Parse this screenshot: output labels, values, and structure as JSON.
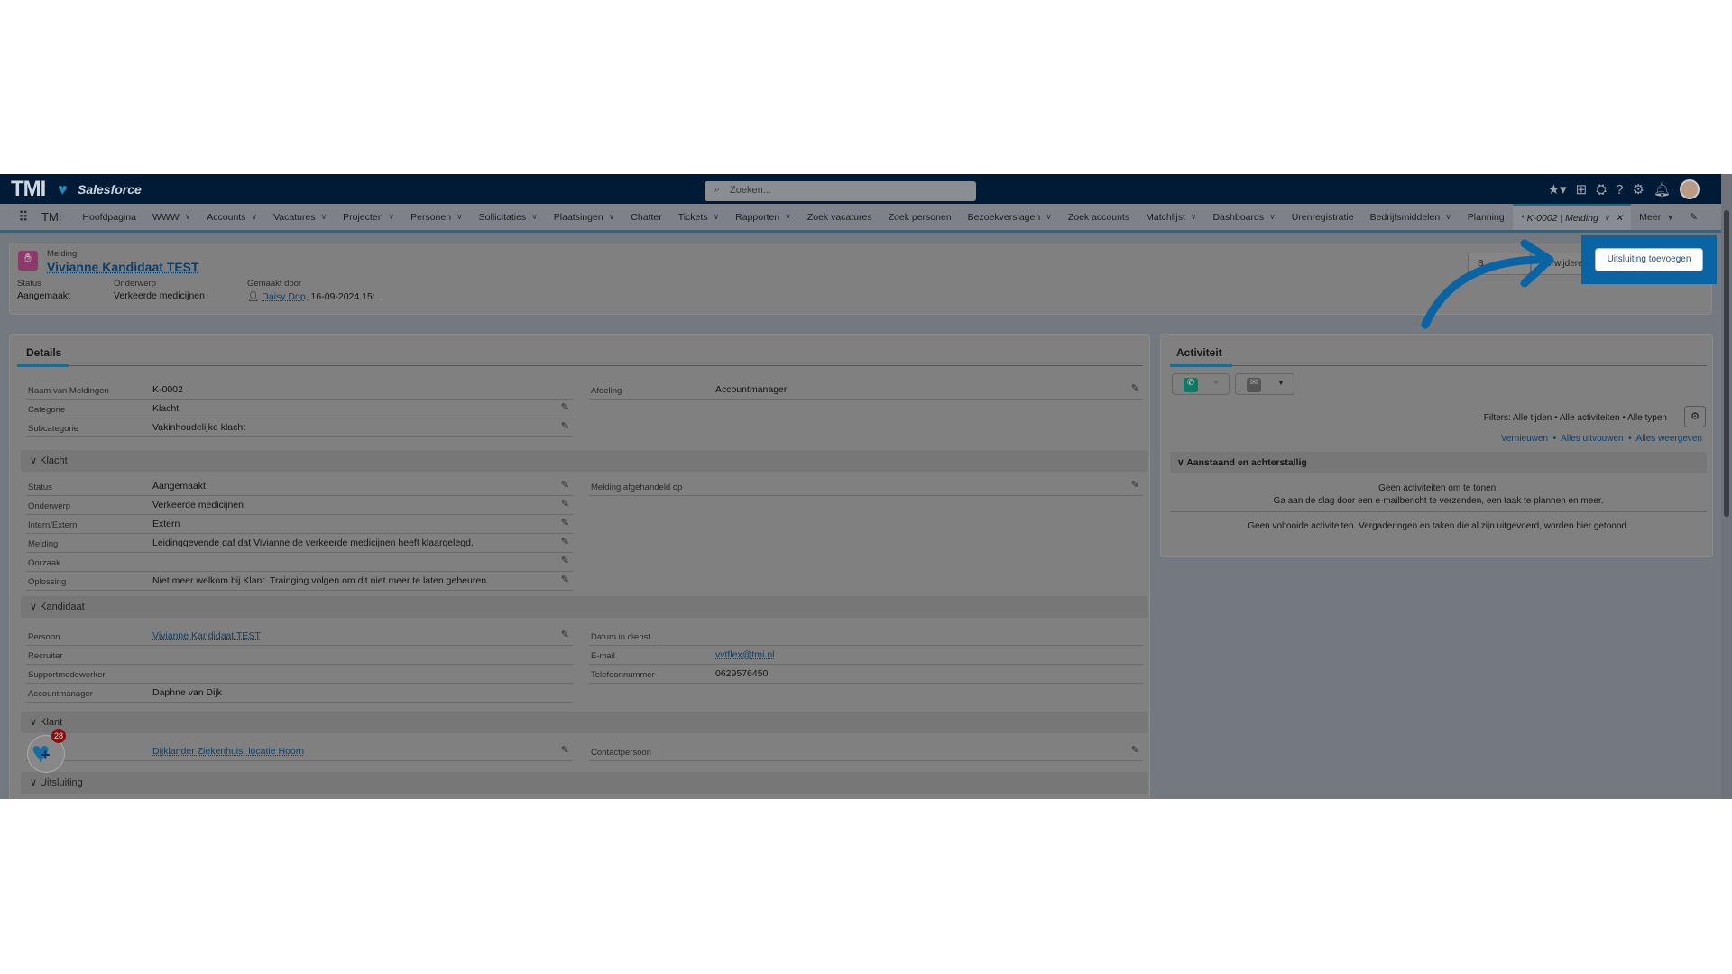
{
  "header": {
    "logo": "TMI",
    "brand": "Salesforce",
    "search_placeholder": "Zoeken..."
  },
  "nav": {
    "app": "TMI",
    "items": [
      {
        "label": "Hoofdpagina",
        "chevron": false
      },
      {
        "label": "WWW",
        "chevron": true
      },
      {
        "label": "Accounts",
        "chevron": true
      },
      {
        "label": "Vacatures",
        "chevron": true
      },
      {
        "label": "Projecten",
        "chevron": true
      },
      {
        "label": "Personen",
        "chevron": true
      },
      {
        "label": "Sollicitaties",
        "chevron": true
      },
      {
        "label": "Plaatsingen",
        "chevron": true
      },
      {
        "label": "Chatter",
        "chevron": false
      },
      {
        "label": "Tickets",
        "chevron": true
      },
      {
        "label": "Rapporten",
        "chevron": true
      },
      {
        "label": "Zoek vacatures",
        "chevron": false
      },
      {
        "label": "Zoek personen",
        "chevron": false
      },
      {
        "label": "Bezoekverslagen",
        "chevron": true
      },
      {
        "label": "Zoek accounts",
        "chevron": false
      },
      {
        "label": "Matchlijst",
        "chevron": true
      },
      {
        "label": "Dashboards",
        "chevron": true
      },
      {
        "label": "Urenregistratie",
        "chevron": false
      },
      {
        "label": "Bedrijfsmiddelen",
        "chevron": true
      },
      {
        "label": "Planning",
        "chevron": false
      }
    ],
    "active_tab": "* K-0002 | Melding",
    "more": "Meer"
  },
  "record": {
    "type": "Melding",
    "name": "Vivianne Kandidaat TEST",
    "highlights": [
      {
        "label": "Status",
        "value": "Aangemaakt"
      },
      {
        "label": "Onderwerp",
        "value": "Verkeerde medicijnen"
      },
      {
        "label": "Gemaakt door",
        "value": "Daisy Dop",
        "suffix": ", 16-09-2024 15:..."
      }
    ],
    "actions": {
      "first": "B",
      "second": "Verwijderen",
      "add_exclusion": "Uitsluiting toevoegen"
    }
  },
  "details": {
    "tab": "Details",
    "top": [
      {
        "label": "Naam van Meldingen",
        "value": "K-0002"
      },
      {
        "label": "Categorie",
        "value": "Klacht"
      },
      {
        "label": "Subcategorie",
        "value": "Vakinhoudelijke klacht"
      }
    ],
    "top_right": [
      {
        "label": "Afdeling",
        "value": "Accountmanager"
      }
    ],
    "sections": {
      "klacht": "Klacht",
      "kandidaat": "Kandidaat",
      "klant": "Klant",
      "uitsluiting": "Uitsluiting"
    },
    "klacht": [
      {
        "label": "Status",
        "value": "Aangemaakt"
      },
      {
        "label": "Onderwerp",
        "value": "Verkeerde medicijnen"
      },
      {
        "label": "Intern/Extern",
        "value": "Extern"
      },
      {
        "label": "Melding",
        "value": "Leidinggevende gaf dat Vivianne de verkeerde medicijnen heeft klaargelegd."
      },
      {
        "label": "Oorzaak",
        "value": ""
      },
      {
        "label": "Oplossing",
        "value": "Niet meer welkom bij Klant. Trainging volgen om dit niet meer te laten gebeuren."
      }
    ],
    "klacht_right": [
      {
        "label": "Melding afgehandeld op",
        "value": ""
      }
    ],
    "kandidaat": [
      {
        "label": "Persoon",
        "value": "Vivianne Kandidaat TEST"
      },
      {
        "label": "Recruiter",
        "value": ""
      },
      {
        "label": "Supportmedewerker",
        "value": ""
      },
      {
        "label": "Accountmanager",
        "value": "Daphne van Dijk"
      }
    ],
    "kandidaat_right": [
      {
        "label": "Datum in dienst",
        "value": ""
      },
      {
        "label": "E-mail",
        "value": "vvtflex@tmi.nl"
      },
      {
        "label": "Telefoonnummer",
        "value": "0629576450"
      }
    ],
    "klant_value": "Dijklander Ziekenhuis, locatie Hoorn",
    "klant_right_label": "Contactpersoon"
  },
  "activity": {
    "tab": "Activiteit",
    "filters": "Filters: Alle tijden • Alle activiteiten • Alle typen",
    "links": [
      "Vernieuwen",
      "Alles uitvouwen",
      "Alles weergeven"
    ],
    "section": "Aanstaand en achterstallig",
    "empty1": "Geen activiteiten om te tonen.",
    "empty2": "Ga aan de slag door een e-mailbericht te verzenden, een taak te plannen en meer.",
    "completed": "Geen voltooide activiteiten. Vergaderingen en taken die al zijn uitgevoerd, worden hier getoond."
  },
  "widget": {
    "badge": "28"
  },
  "colors": {
    "highlight": "#0a64a4",
    "header": "#011a35"
  }
}
